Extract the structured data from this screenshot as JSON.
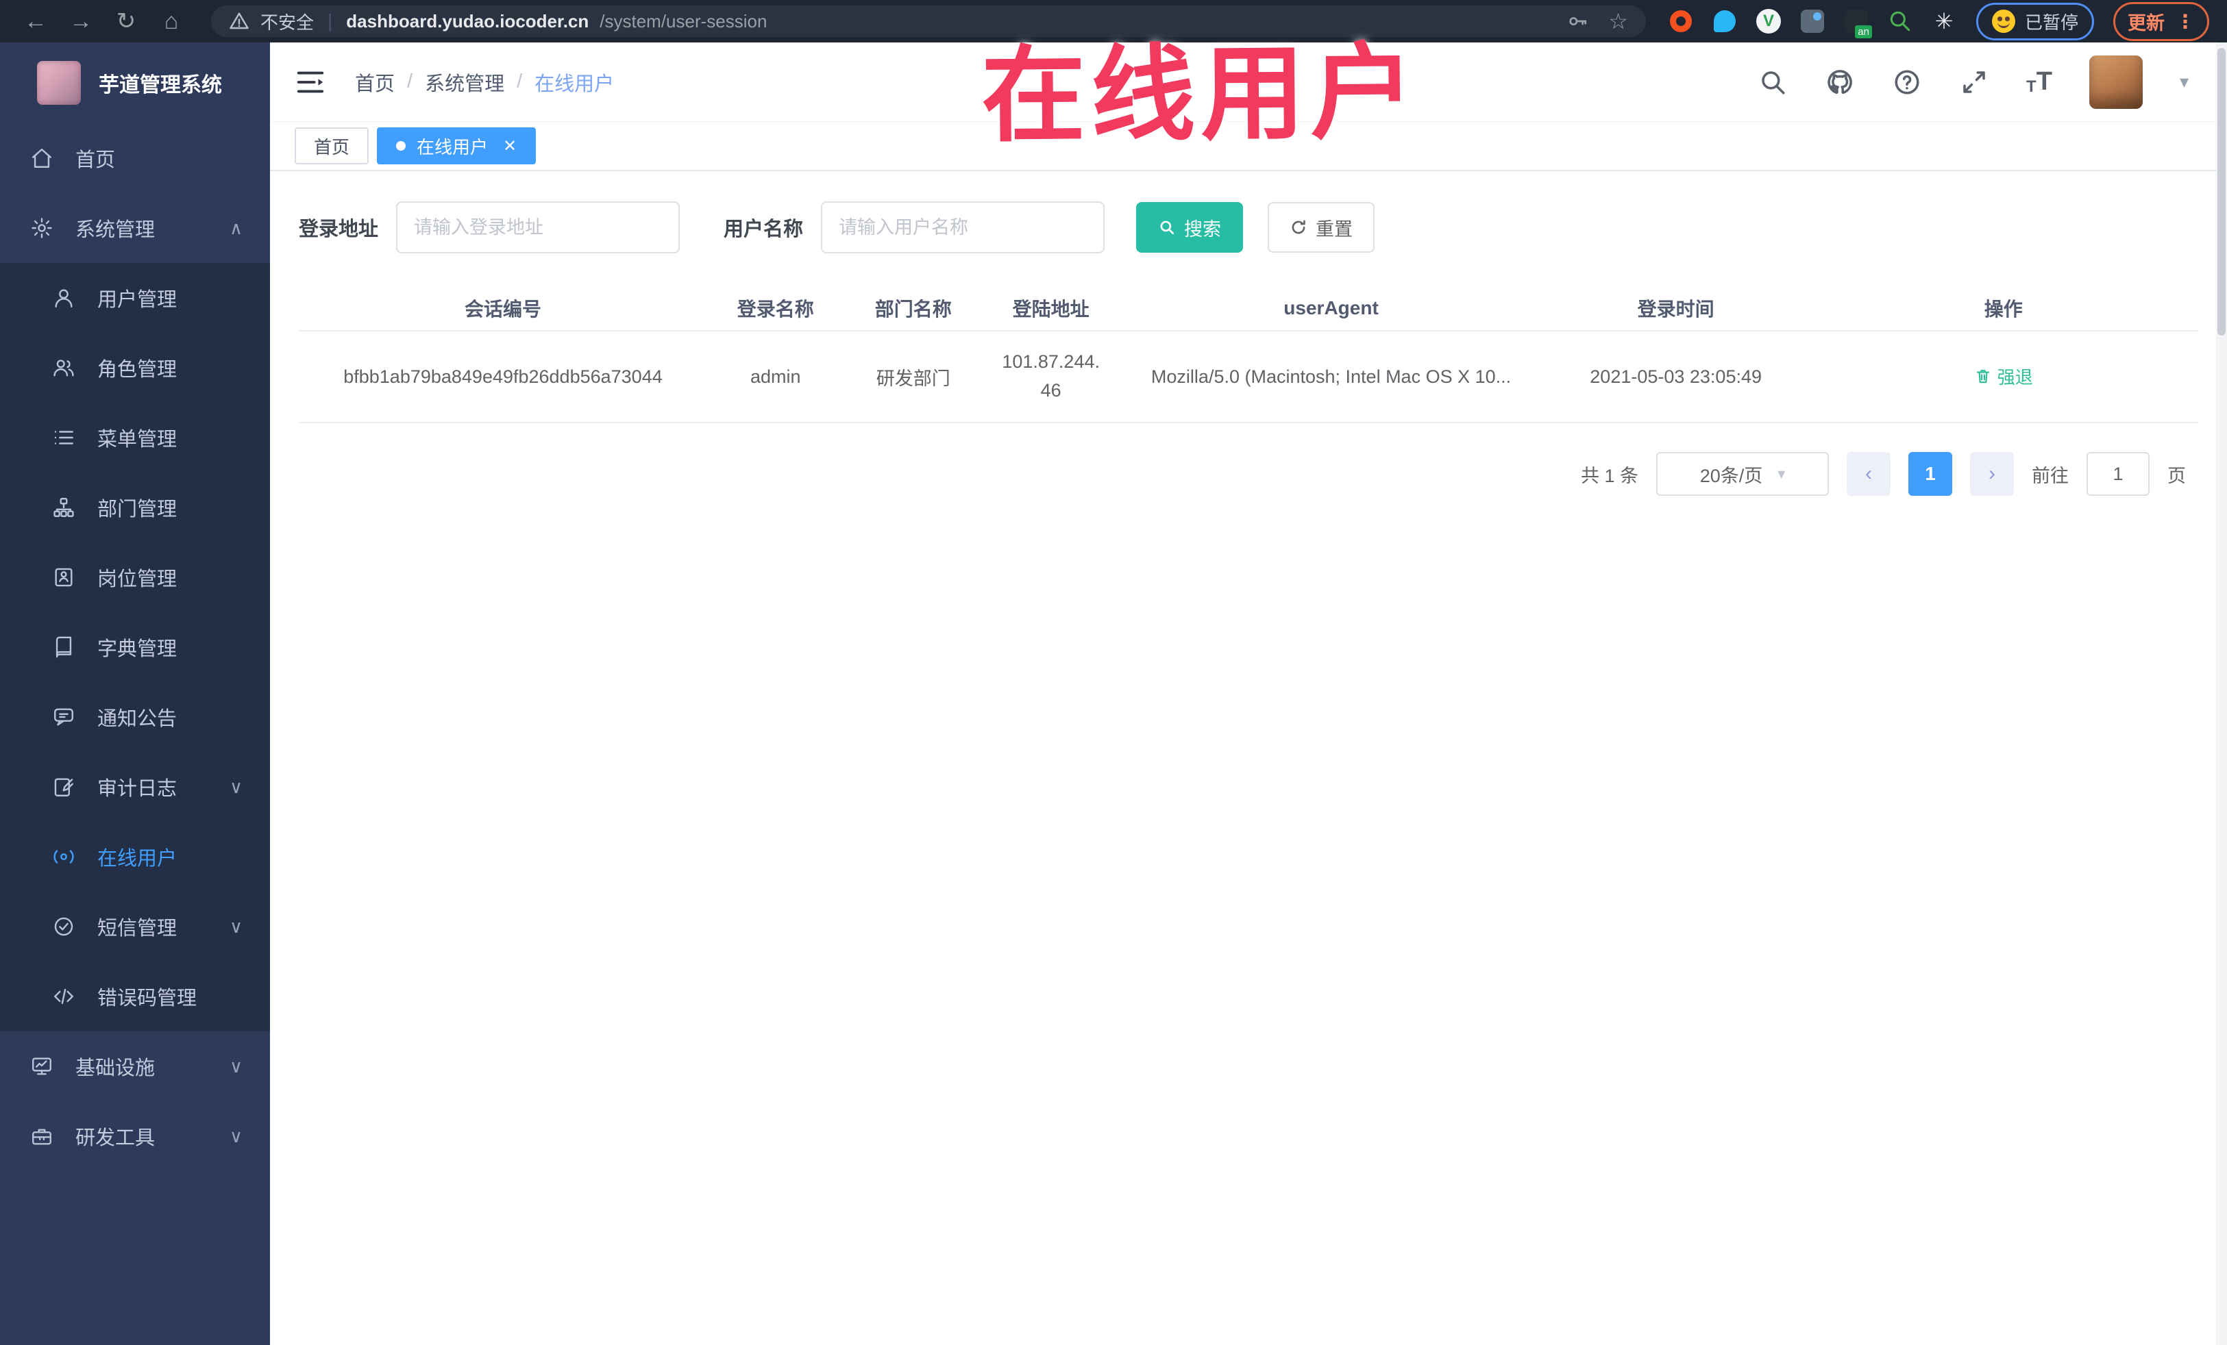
{
  "browser": {
    "security_label": "不安全",
    "url_host": "dashboard.yudao.iocoder.cn",
    "url_path": "/system/user-session",
    "paused_label": "已暂停",
    "update_label": "更新"
  },
  "annotation": {
    "text": "在线用户"
  },
  "sidebar": {
    "logo_title": "芋道管理系统",
    "items": [
      {
        "label": "首页"
      },
      {
        "label": "系统管理",
        "chevron": "up"
      },
      {
        "label": "用户管理"
      },
      {
        "label": "角色管理"
      },
      {
        "label": "菜单管理"
      },
      {
        "label": "部门管理"
      },
      {
        "label": "岗位管理"
      },
      {
        "label": "字典管理"
      },
      {
        "label": "通知公告"
      },
      {
        "label": "审计日志",
        "chevron": "down"
      },
      {
        "label": "在线用户",
        "active": true
      },
      {
        "label": "短信管理",
        "chevron": "down"
      },
      {
        "label": "错误码管理"
      },
      {
        "label": "基础设施",
        "chevron": "down"
      },
      {
        "label": "研发工具",
        "chevron": "down"
      }
    ]
  },
  "header": {
    "breadcrumb": [
      "首页",
      "系统管理",
      "在线用户"
    ]
  },
  "tabs": [
    {
      "label": "首页",
      "active": false
    },
    {
      "label": "在线用户",
      "active": true
    }
  ],
  "filters": {
    "login_address_label": "登录地址",
    "login_address_placeholder": "请输入登录地址",
    "username_label": "用户名称",
    "username_placeholder": "请输入用户名称",
    "search_label": "搜索",
    "reset_label": "重置"
  },
  "table": {
    "columns": [
      "会话编号",
      "登录名称",
      "部门名称",
      "登陆地址",
      "userAgent",
      "登录时间",
      "操作"
    ],
    "row": {
      "session_id": "bfbb1ab79ba849e49fb26ddb56a73044",
      "login_name": "admin",
      "dept_name": "研发部门",
      "login_ip": "101.87.244.46",
      "user_agent": "Mozilla/5.0 (Macintosh; Intel Mac OS X 10...",
      "login_time": "2021-05-03 23:05:49",
      "action_label": "强退"
    }
  },
  "pagination": {
    "total_label": "共 1 条",
    "page_size_label": "20条/页",
    "current_page": "1",
    "goto_label": "前往",
    "goto_value": "1",
    "page_suffix": "页"
  },
  "colors": {
    "accent_blue": "#409eff",
    "search_button_teal": "#27bda4",
    "action_green": "#2fbf96",
    "annotation_pink": "#f2395e",
    "sidebar_bg": "#2d3a5a",
    "submenu_bg": "#232f47",
    "browser_bar_bg": "#1e2634"
  }
}
